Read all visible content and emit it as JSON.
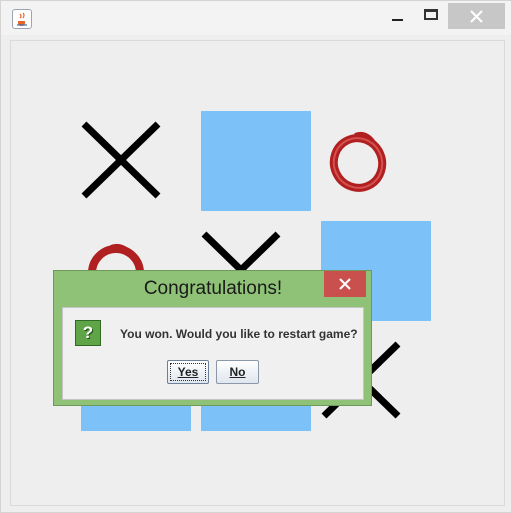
{
  "window": {
    "app_icon": "java-cup-icon",
    "controls": {
      "minimize": "minimize-icon",
      "maximize": "maximize-icon",
      "close": "close-icon"
    }
  },
  "board": {
    "cells": [
      {
        "row": 0,
        "col": 0,
        "mark": "X"
      },
      {
        "row": 0,
        "col": 1,
        "mark": "empty-blue"
      },
      {
        "row": 0,
        "col": 2,
        "mark": "O"
      },
      {
        "row": 1,
        "col": 0,
        "mark": "O"
      },
      {
        "row": 1,
        "col": 1,
        "mark": "X"
      },
      {
        "row": 1,
        "col": 2,
        "mark": "empty-blue"
      },
      {
        "row": 2,
        "col": 0,
        "mark": "empty-blue"
      },
      {
        "row": 2,
        "col": 1,
        "mark": "empty-blue"
      },
      {
        "row": 2,
        "col": 2,
        "mark": "X"
      }
    ],
    "colors": {
      "empty": "#7cc1f7",
      "x": "#000000",
      "o": "#b02020"
    }
  },
  "dialog": {
    "title": "Congratulations!",
    "message": "You won. Would you like to restart game?",
    "icon": "question-icon",
    "icon_glyph": "?",
    "yes_label": "Yes",
    "no_label": "No",
    "colors": {
      "frame": "#8fc276",
      "close": "#c9504c"
    }
  }
}
